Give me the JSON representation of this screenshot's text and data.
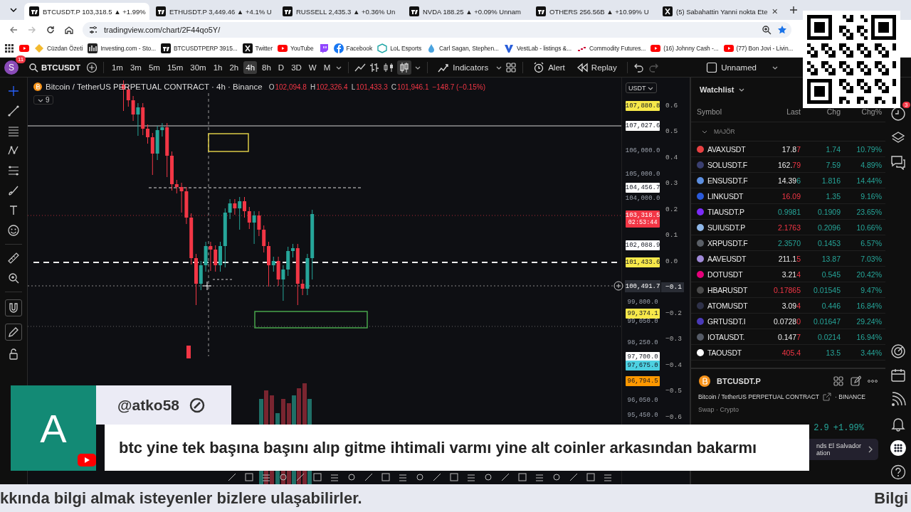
{
  "browser": {
    "tabs": [
      {
        "title": "BTCUSDT.P 103,318.5 ▲ +1.99%",
        "selected": true
      },
      {
        "title": "ETHUSDT.P 3,449.46 ▲ +4.1% U",
        "selected": false
      },
      {
        "title": "RUSSELL 2,435.3 ▲ +0.36% Un",
        "selected": false
      },
      {
        "title": "NVDA 188.25 ▲ +0.09% Unnam",
        "selected": false
      },
      {
        "title": "OTHERS 256.56B ▲ +10.99% U",
        "selected": false
      },
      {
        "title": "(5) Sabahattin Yanni nokta Ete",
        "selected": false
      }
    ],
    "address": "tradingview.com/chart/2F44qo5Y/",
    "bookmarks": [
      {
        "kind": "icon"
      },
      {
        "kind": "link",
        "label": "Cüzdan Özeti"
      },
      {
        "kind": "link",
        "label": "Investing.com - Sto..."
      },
      {
        "kind": "link",
        "label": "BTCUSDTPERP 3915..."
      },
      {
        "kind": "link",
        "label": "Twitter"
      },
      {
        "kind": "link",
        "label": "YouTube"
      },
      {
        "kind": "icon"
      },
      {
        "kind": "link",
        "label": "Facebook"
      },
      {
        "kind": "link",
        "label": "LoL Esports"
      },
      {
        "kind": "link",
        "label": "Carl Sagan, Stephen..."
      },
      {
        "kind": "link",
        "label": "VestLab - listings &..."
      },
      {
        "kind": "link",
        "label": "Commodity Futures..."
      },
      {
        "kind": "link",
        "label": "(16) Johnny Cash -..."
      },
      {
        "kind": "link",
        "label": "(77) Bon Jovi - Livin..."
      }
    ]
  },
  "toolbar": {
    "user_initial": "S",
    "notifications": "11",
    "symbol": "BTCUSDT",
    "intervals": [
      {
        "label": "1m",
        "selected": false
      },
      {
        "label": "3m",
        "selected": false
      },
      {
        "label": "5m",
        "selected": false
      },
      {
        "label": "15m",
        "selected": false
      },
      {
        "label": "30m",
        "selected": false
      },
      {
        "label": "1h",
        "selected": false
      },
      {
        "label": "2h",
        "selected": false
      },
      {
        "label": "4h",
        "selected": true
      },
      {
        "label": "8h",
        "selected": false
      },
      {
        "label": "D",
        "selected": false
      },
      {
        "label": "3D",
        "selected": false
      },
      {
        "label": "W",
        "selected": false
      },
      {
        "label": "M",
        "selected": false
      }
    ],
    "indicators": "Indicators",
    "alert": "Alert",
    "replay": "Replay",
    "layout_name": "Unnamed"
  },
  "chart": {
    "legend": {
      "title": "Bitcoin / TetherUS PERPETUAL CONTRACT · 4h · Binance",
      "ohlc": [
        {
          "label": "O",
          "value": "102,094.8"
        },
        {
          "label": "H",
          "value": "102,326.4"
        },
        {
          "label": "L",
          "value": "101,433.3"
        },
        {
          "label": "C",
          "value": "101,946.1"
        }
      ],
      "change": "−148.7 (−0.15%)",
      "indicator_count": "9"
    },
    "currency": "USDT",
    "price_labels": [
      {
        "text": "107,880.8",
        "kind": "tag",
        "color": "#f7e84a"
      },
      {
        "text": "107,027.6",
        "kind": "tag",
        "color": "#ffffff"
      },
      {
        "text": "106,000.0",
        "kind": "plain"
      },
      {
        "text": "105,000.0",
        "kind": "plain"
      },
      {
        "text": "104,456.7",
        "kind": "tag",
        "color": "#ffffff"
      },
      {
        "text": "104,000.0",
        "kind": "plain"
      },
      {
        "text": "103,318.5",
        "kind": "tag",
        "color": "#f23645",
        "countdown": "02:53:44"
      },
      {
        "text": "102,088.9",
        "kind": "tag",
        "color": "#ffffff"
      },
      {
        "text": "101,433.6",
        "kind": "tag",
        "color": "#f7e84a"
      },
      {
        "text": "99,800.0",
        "kind": "plain"
      },
      {
        "text": "99,374.1",
        "kind": "tag",
        "color": "#f7e84a"
      },
      {
        "text": "99,050.0",
        "kind": "plain"
      },
      {
        "text": "98,250.0",
        "kind": "plain"
      },
      {
        "text": "97,700.0",
        "kind": "tag",
        "color": "#ffffff"
      },
      {
        "text": "97,675.0",
        "kind": "tag",
        "color": "#4dd0e1"
      },
      {
        "text": "96,794.5",
        "kind": "tag",
        "color": "#ff9800"
      },
      {
        "text": "96,050.0",
        "kind": "plain"
      },
      {
        "text": "95,450.0",
        "kind": "plain"
      }
    ],
    "crosshair_price": "100,491.7",
    "percent_scale": [
      {
        "text": "0.6",
        "highlighted": false
      },
      {
        "text": "0.5",
        "highlighted": false
      },
      {
        "text": "0.4",
        "highlighted": false
      },
      {
        "text": "0.3",
        "highlighted": false
      },
      {
        "text": "0.2",
        "highlighted": false
      },
      {
        "text": "0.1",
        "highlighted": false
      },
      {
        "text": "0.0",
        "highlighted": false
      },
      {
        "text": "−0.1",
        "highlighted": true
      },
      {
        "text": "−0.2",
        "highlighted": false
      },
      {
        "text": "−0.3",
        "highlighted": false
      },
      {
        "text": "−0.4",
        "highlighted": false
      },
      {
        "text": "−0.5",
        "highlighted": false
      },
      {
        "text": "−0.6",
        "highlighted": false
      }
    ]
  },
  "watchlist": {
    "title": "Watchlist",
    "columns": [
      "Symbol",
      "Last",
      "Chg",
      "Chg%"
    ],
    "group": {
      "name": "MAJÖR",
      "expanded": true
    },
    "rows": [
      {
        "symbol": "AVAXUSDT",
        "color": "#e84142",
        "kind": "flat",
        "last": "17.8",
        "tick": "7",
        "tick_up": false,
        "chg": "1.74",
        "chg_pct": "10.79%"
      },
      {
        "symbol": "SOLUSDT.F",
        "color": "#3a3f70",
        "kind": "flat",
        "last": "162.",
        "tick": "79",
        "tick_up": false,
        "chg": "7.59",
        "chg_pct": "4.89%"
      },
      {
        "symbol": "ENSUSDT.F",
        "color": "#5c8fe0",
        "kind": "flat",
        "last": "14.39",
        "tick": "6",
        "tick_up": true,
        "chg": "1.816",
        "chg_pct": "14.44%"
      },
      {
        "symbol": "LINKUSDT",
        "color": "#2a5ada",
        "kind": "down",
        "last": "16.09",
        "chg": "1.35",
        "chg_pct": "9.16%"
      },
      {
        "symbol": "TIAUSDT.P",
        "color": "#7b2bf9",
        "kind": "up",
        "last": "0.9981",
        "chg": "0.1909",
        "chg_pct": "23.65%"
      },
      {
        "symbol": "SUIUSDT.P",
        "color": "#8fb8e8",
        "kind": "down",
        "last": "2.1763",
        "chg": "0.2096",
        "chg_pct": "10.66%"
      },
      {
        "symbol": "XRPUSDT.F",
        "color": "#5a5f66",
        "kind": "up",
        "last": "2.3570",
        "chg": "0.1453",
        "chg_pct": "6.57%"
      },
      {
        "symbol": "AAVEUSDT",
        "color": "#a08ad8",
        "kind": "flat",
        "last": "211.1",
        "tick": "5",
        "tick_up": false,
        "chg": "13.87",
        "chg_pct": "7.03%"
      },
      {
        "symbol": "DOTUSDT",
        "color": "#e6007a",
        "kind": "flat",
        "last": "3.21",
        "tick": "4",
        "tick_up": false,
        "chg": "0.545",
        "chg_pct": "20.42%"
      },
      {
        "symbol": "HBARUSDT",
        "color": "#4a4a4a",
        "kind": "down",
        "last": "0.17865",
        "chg": "0.01545",
        "chg_pct": "9.47%"
      },
      {
        "symbol": "ATOMUSDT",
        "color": "#2e3148",
        "kind": "flat",
        "last": "3.09",
        "tick": "4",
        "tick_up": false,
        "chg": "0.446",
        "chg_pct": "16.84%"
      },
      {
        "symbol": "GRTUSDT.I",
        "color": "#4a3ab8",
        "kind": "flat",
        "last": "0.0728",
        "tick": "0",
        "tick_up": false,
        "chg": "0.01647",
        "chg_pct": "29.24%"
      },
      {
        "symbol": "IOTAUSDT.",
        "color": "#555b66",
        "kind": "flat",
        "last": "0.147",
        "tick": "7",
        "tick_up": false,
        "chg": "0.0214",
        "chg_pct": "16.94%"
      },
      {
        "symbol": "TAOUSDT",
        "color": "#ffffff",
        "kind": "down",
        "last": "405.4",
        "chg": "13.5",
        "chg_pct": "3.44%"
      }
    ]
  },
  "symbol_panel": {
    "symbol": "BTCUSDT.P",
    "description": "Bitcoin / TetherUS PERPETUAL CONTRACT",
    "exchange": "· BINANCE",
    "category": "Swap · Crypto",
    "change": "2.9",
    "change_pct": "+1.99%",
    "news": [
      "nds El Salvador",
      "ation"
    ]
  },
  "right_rail": {
    "alerts_badge": "3"
  },
  "comment": {
    "initial": "A",
    "author": "@atko58",
    "message": "btc yine tek başına başını alıp gitme ihtimali varmı yine alt coinler arkasından bakarmı"
  },
  "ticker": {
    "left": "kkında bilgi almak isteyenler bizlere ulaşabilirler.",
    "right": "Bilgi"
  }
}
